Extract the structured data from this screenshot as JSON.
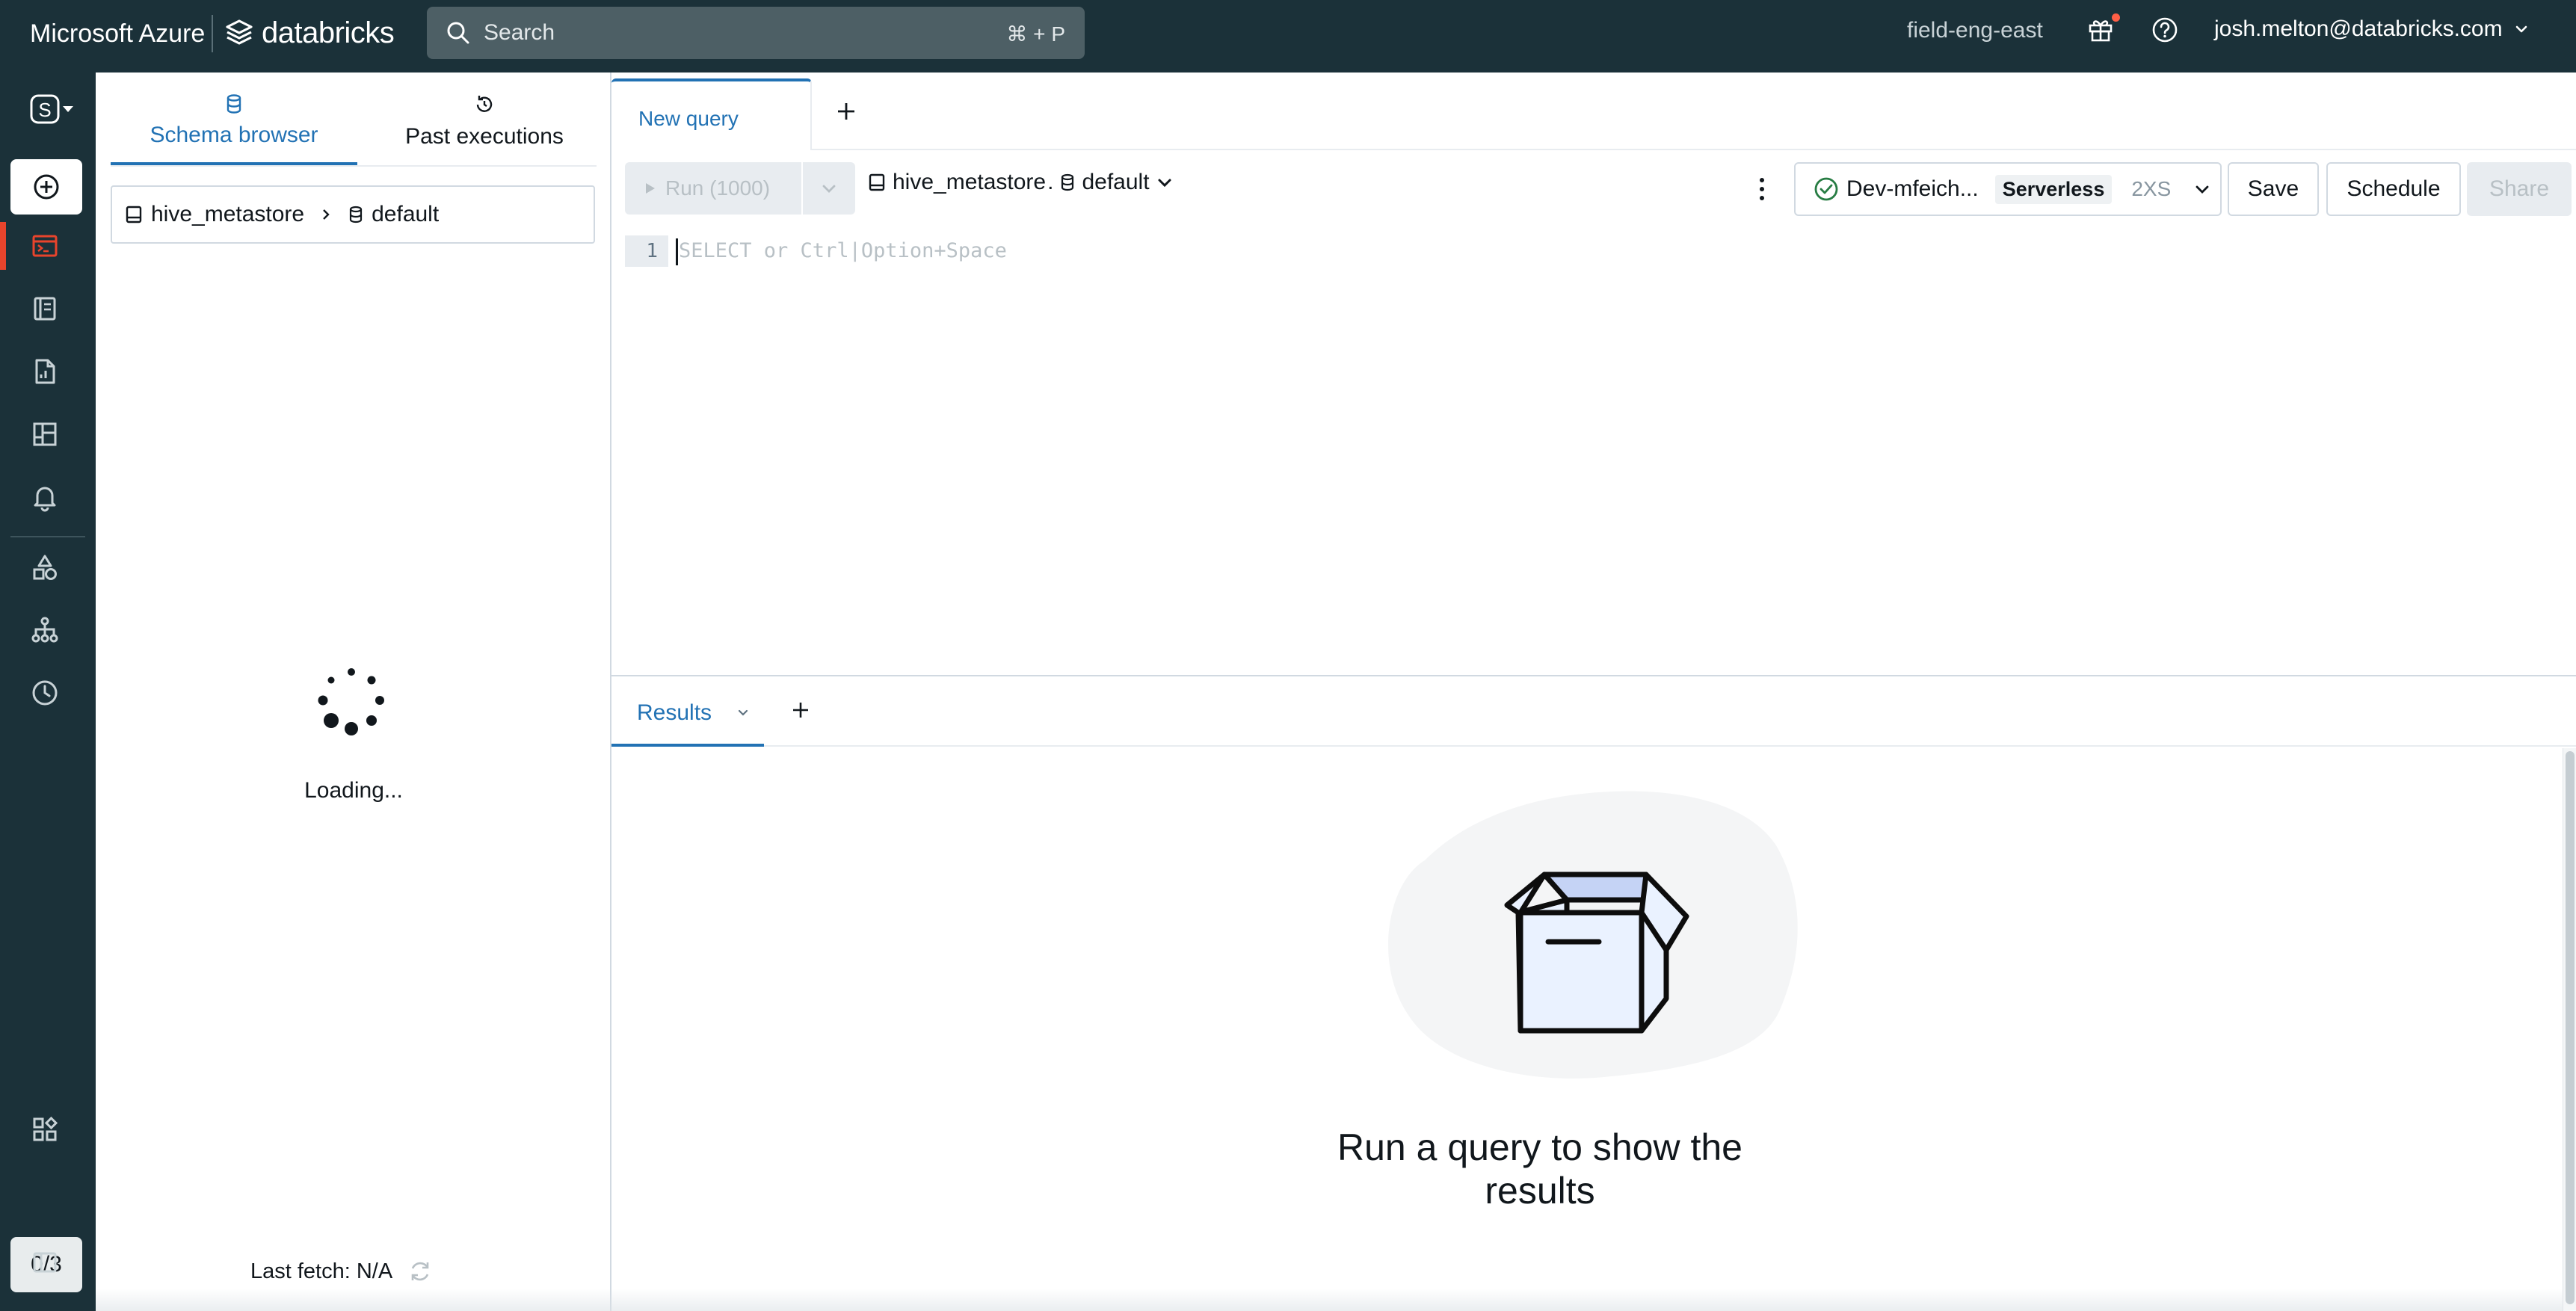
{
  "topbar": {
    "cloud_label": "Microsoft Azure",
    "product_label": "databricks",
    "search_placeholder": "Search",
    "search_shortcut": "⌘ + P",
    "workspace_name": "field-eng-east",
    "user_email": "josh.melton@databricks.com"
  },
  "nav": {
    "workspace_letter": "S",
    "counter": "0/3",
    "accent_color": "#e8442c"
  },
  "schema_panel": {
    "tabs": [
      {
        "label": "Schema browser",
        "active": true
      },
      {
        "label": "Past executions",
        "active": false
      }
    ],
    "catalog": "hive_metastore",
    "schema": "default",
    "loading_text": "Loading...",
    "last_fetch": "Last fetch: N/A"
  },
  "editor": {
    "tab_label": "New query",
    "run_label": "Run (1000)",
    "catalog": "hive_metastore",
    "catalog_sep": ".",
    "schema": "default",
    "warehouse_name": "Dev-mfeich...",
    "warehouse_type": "Serverless",
    "warehouse_size": "2XS",
    "save_label": "Save",
    "schedule_label": "Schedule",
    "share_label": "Share",
    "line_number": "1",
    "placeholder": "SELECT or Ctrl|Option+Space"
  },
  "results": {
    "tab_label": "Results",
    "empty_line1": "Run a query to show the",
    "empty_line2": "results"
  },
  "colors": {
    "topbar_bg": "#1b3139",
    "primary": "#2272b4",
    "border": "#d1d9e1",
    "success": "#277c43"
  }
}
